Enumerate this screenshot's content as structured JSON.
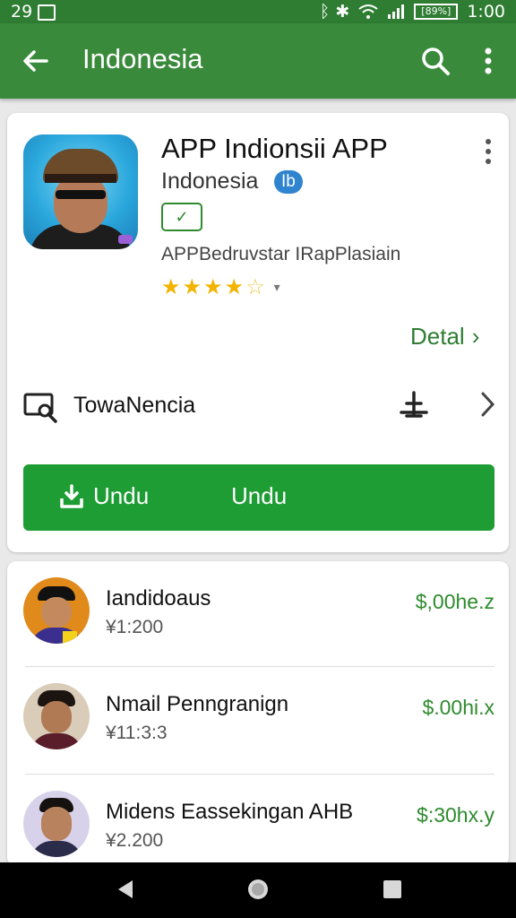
{
  "status": {
    "time": "29",
    "icons": "ᛒ ✱",
    "battery": "[89%]",
    "clock": "1:00"
  },
  "appbar": {
    "title": "Indonesia",
    "back_icon": "arrow-left-icon",
    "search_icon": "search-icon",
    "more_icon": "more-vert-icon"
  },
  "app": {
    "title": "APP Indionsii APP",
    "developer": "Indonesia",
    "developer_badge": "Ib",
    "verify_glyph": "✓",
    "category": "APPBedruvstar IRapPlasiain",
    "stars": "★★★★",
    "stars_half": "☆",
    "stars_caret": "▾",
    "rating_out_of_5": 4.5,
    "details_label": "Detal",
    "details_chevron": "›",
    "install_row_label": "TowaNencia",
    "download_label_1": "Undu",
    "download_label_2": "Undu",
    "accent_color": "#1f9d35"
  },
  "list": [
    {
      "name": "Iandidoaus",
      "sub": "¥1:200",
      "price": "$,00he.z"
    },
    {
      "name": "Nmail Penngranign",
      "sub": "¥11:3:3",
      "price": "$.00hi.x"
    },
    {
      "name": "Midens Eassekingan AHB",
      "sub": "¥2.200",
      "price": "$:30hx.y"
    }
  ]
}
